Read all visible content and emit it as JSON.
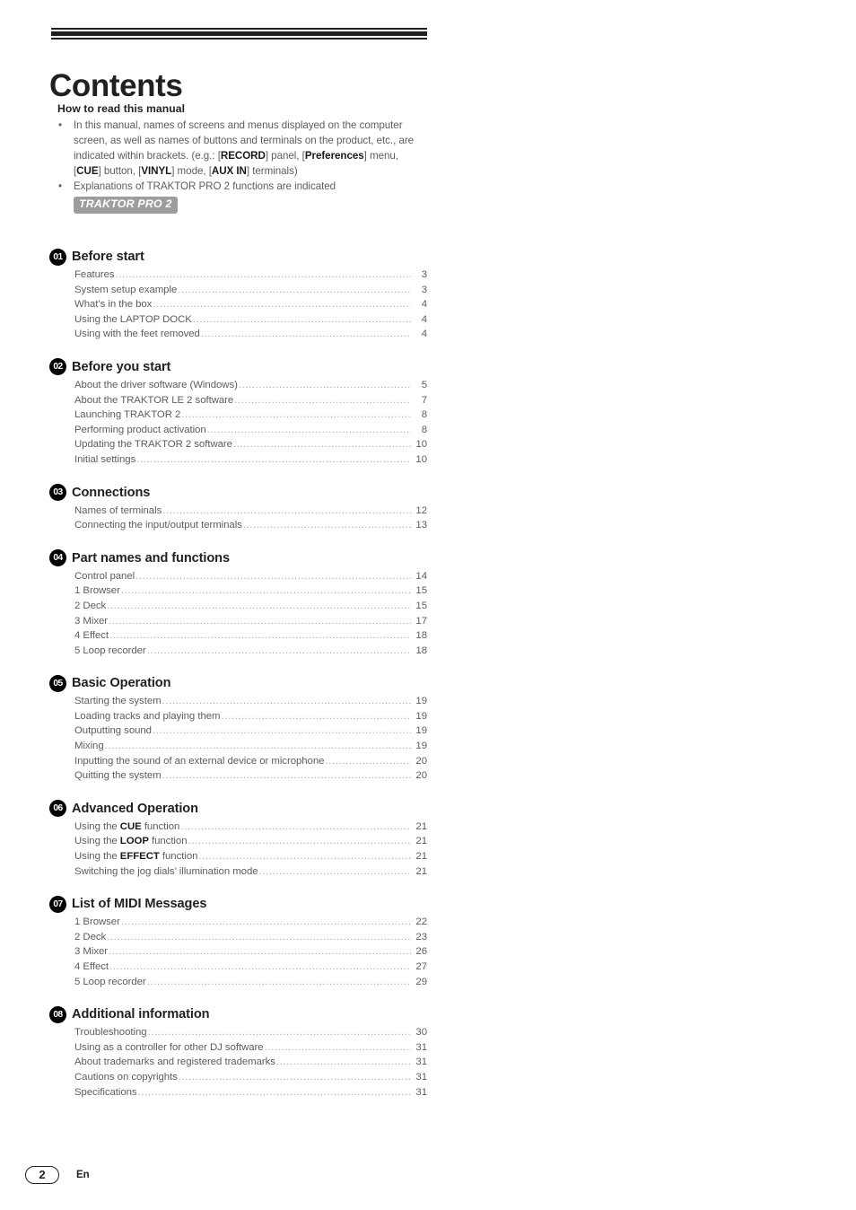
{
  "document": {
    "title": "Contents",
    "page_number": "2",
    "language_code": "En"
  },
  "intro": {
    "heading": "How to read this manual",
    "bullet_mark": "•",
    "bullets": [
      "In this manual, names of screens and menus displayed on the computer screen, as well as names of buttons and terminals on the product, etc., are indicated within brackets. (e.g.: [<b>RECORD</b>] panel, [<b>Preferences</b>] menu, [<b>CUE</b>] button, [<b>VINYL</b>] mode, [<b>AUX IN</b>] terminals)",
      "Explanations of TRAKTOR PRO 2 functions are indicated"
    ],
    "badge_label": "TRAKTOR PRO 2"
  },
  "toc": {
    "dot_leader": "....................................................................................................................",
    "chapters": [
      {
        "number": "01",
        "title": "Before start",
        "entries": [
          {
            "label": "Features",
            "page": "3"
          },
          {
            "label": "System setup example",
            "page": "3"
          },
          {
            "label": "What’s in the box",
            "page": "4"
          },
          {
            "label": "Using the LAPTOP DOCK",
            "page": "4"
          },
          {
            "label": "Using with the feet removed",
            "page": "4"
          }
        ]
      },
      {
        "number": "02",
        "title": "Before you start",
        "entries": [
          {
            "label": "About the driver software (Windows)",
            "page": "5"
          },
          {
            "label": "About the TRAKTOR LE 2 software",
            "page": "7"
          },
          {
            "label": "Launching TRAKTOR 2",
            "page": "8"
          },
          {
            "label": "Performing product activation",
            "page": "8"
          },
          {
            "label": "Updating the TRAKTOR 2 software",
            "page": "10"
          },
          {
            "label": "Initial settings",
            "page": "10"
          }
        ]
      },
      {
        "number": "03",
        "title": "Connections",
        "entries": [
          {
            "label": "Names of terminals",
            "page": "12"
          },
          {
            "label": "Connecting the input/output terminals",
            "page": "13"
          }
        ]
      },
      {
        "number": "04",
        "title": "Part names and functions",
        "entries": [
          {
            "label": "Control panel",
            "page": "14"
          },
          {
            "label": "1 Browser",
            "page": "15"
          },
          {
            "label": "2 Deck",
            "page": "15"
          },
          {
            "label": "3 Mixer",
            "page": "17"
          },
          {
            "label": "4 Effect",
            "page": "18"
          },
          {
            "label": "5 Loop recorder",
            "page": "18"
          }
        ]
      },
      {
        "number": "05",
        "title": "Basic Operation",
        "entries": [
          {
            "label": "Starting the system",
            "page": "19"
          },
          {
            "label": "Loading tracks and playing them",
            "page": "19"
          },
          {
            "label": "Outputting sound",
            "page": "19"
          },
          {
            "label": "Mixing",
            "page": "19"
          },
          {
            "label": "Inputting the sound of an external device or microphone",
            "page": "20"
          },
          {
            "label": "Quitting the system",
            "page": "20"
          }
        ]
      },
      {
        "number": "06",
        "title": "Advanced Operation",
        "entries": [
          {
            "label": "Using the <b>CUE</b> function",
            "page": "21"
          },
          {
            "label": "Using the <b>LOOP</b> function",
            "page": "21"
          },
          {
            "label": "Using the <b>EFFECT</b> function",
            "page": "21"
          },
          {
            "label": "Switching the jog dials’ illumination mode",
            "page": "21"
          }
        ]
      },
      {
        "number": "07",
        "title": "List of MIDI Messages",
        "entries": [
          {
            "label": "1 Browser",
            "page": "22"
          },
          {
            "label": "2 Deck",
            "page": "23"
          },
          {
            "label": "3 Mixer",
            "page": "26"
          },
          {
            "label": "4 Effect",
            "page": "27"
          },
          {
            "label": "5 Loop recorder",
            "page": "29"
          }
        ]
      },
      {
        "number": "08",
        "title": "Additional information",
        "entries": [
          {
            "label": "Troubleshooting",
            "page": "30"
          },
          {
            "label": "Using as a controller for other DJ software",
            "page": "31"
          },
          {
            "label": "About trademarks and registered trademarks",
            "page": "31"
          },
          {
            "label": "Cautions on copyrights",
            "page": "31"
          },
          {
            "label": "Specifications",
            "page": "31"
          }
        ]
      }
    ]
  }
}
